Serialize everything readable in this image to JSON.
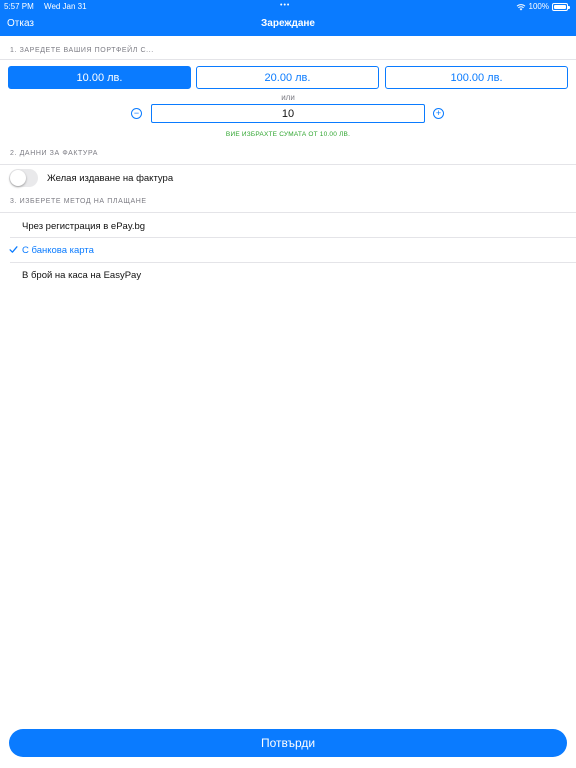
{
  "status_bar": {
    "time": "5:57 PM",
    "date": "Wed Jan 31",
    "battery": "100%"
  },
  "nav": {
    "cancel": "Отказ",
    "title": "Зареждане"
  },
  "sections": {
    "wallet": "1. Заредете вашия портфейл с...",
    "invoice": "2. Данни за фактура",
    "payment": "3. Изберете метод на плащане"
  },
  "amounts": [
    {
      "label": "10.00 лв.",
      "selected": true
    },
    {
      "label": "20.00 лв.",
      "selected": false
    },
    {
      "label": "100.00 лв.",
      "selected": false
    }
  ],
  "or_label": "или",
  "custom_amount": {
    "value": "10"
  },
  "summary_text": "ВИЕ ИЗБРАХТЕ СУМАТА ОТ 10.00 ЛВ.",
  "invoice_toggle": {
    "label": "Желая издаване на фактура",
    "on": false
  },
  "payment_methods": [
    {
      "label": "Чрез регистрация в ePay.bg",
      "selected": false
    },
    {
      "label": "С банкова карта",
      "selected": true
    },
    {
      "label": "В брой на каса на EasyPay",
      "selected": false
    }
  ],
  "confirm_label": "Потвърди",
  "colors": {
    "accent": "#0a7bff",
    "success": "#2fa52f",
    "muted": "#7c7c84"
  }
}
